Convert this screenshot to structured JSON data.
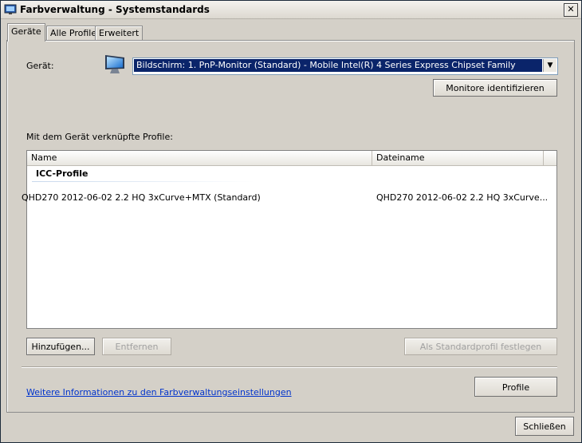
{
  "window": {
    "title": "Farbverwaltung - Systemstandards",
    "close_glyph": "✕"
  },
  "tabs": [
    {
      "label": "Geräte",
      "active": true
    },
    {
      "label": "Alle Profile",
      "active": false
    },
    {
      "label": "Erweitert",
      "active": false
    }
  ],
  "device": {
    "label": "Gerät:",
    "icon": "monitor-icon",
    "selected": "Bildschirm: 1. PnP-Monitor (Standard) - Mobile Intel(R) 4 Series Express Chipset Family",
    "identify_button": "Monitore identifizieren"
  },
  "profiles": {
    "label": "Mit dem Gerät verknüpfte Profile:",
    "columns": [
      "Name",
      "Dateiname"
    ],
    "group": "ICC-Profile",
    "rows": [
      {
        "name": "QHD270 2012-06-02 2.2 HQ 3xCurve+MTX (Standard)",
        "file": "QHD270 2012-06-02 2.2 HQ 3xCurve..."
      }
    ]
  },
  "buttons": {
    "add": "Hinzufügen...",
    "remove": "Entfernen",
    "set_default": "Als Standardprofil festlegen",
    "profile": "Profile",
    "close": "Schließen"
  },
  "link": "Weitere Informationen zu den Farbverwaltungseinstellungen",
  "colors": {
    "selection": "#0a246a",
    "link": "#0033cc",
    "dialog_bg": "#d4d0c8"
  }
}
